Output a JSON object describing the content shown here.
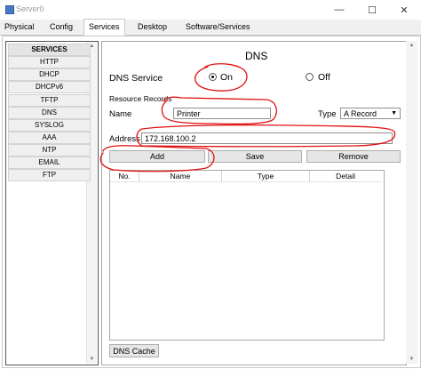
{
  "window": {
    "title": "Server0"
  },
  "tabs": [
    {
      "label": "Physical"
    },
    {
      "label": "Config"
    },
    {
      "label": "Services",
      "active": true
    },
    {
      "label": "Desktop"
    },
    {
      "label": "Software/Services"
    }
  ],
  "sidebar": {
    "header": "SERVICES",
    "items": [
      "HTTP",
      "DHCP",
      "DHCPv6",
      "TFTP",
      "DNS",
      "SYSLOG",
      "AAA",
      "NTP",
      "EMAIL",
      "FTP"
    ]
  },
  "dns": {
    "heading": "DNS",
    "service_label": "DNS Service",
    "on_label": "On",
    "off_label": "Off",
    "service_state": "On",
    "resource_records_label": "Resource Records",
    "name_label": "Name",
    "name_value": "Printer",
    "type_label": "Type",
    "type_value": "A Record",
    "address_label": "Address",
    "address_value": "172.168.100.2",
    "buttons": {
      "add": "Add",
      "save": "Save",
      "remove": "Remove"
    },
    "table_columns": [
      "No.",
      "Name",
      "Type",
      "Detail"
    ],
    "cache_button": "DNS Cache"
  },
  "colors": {
    "annotation_red": "#e01010"
  }
}
